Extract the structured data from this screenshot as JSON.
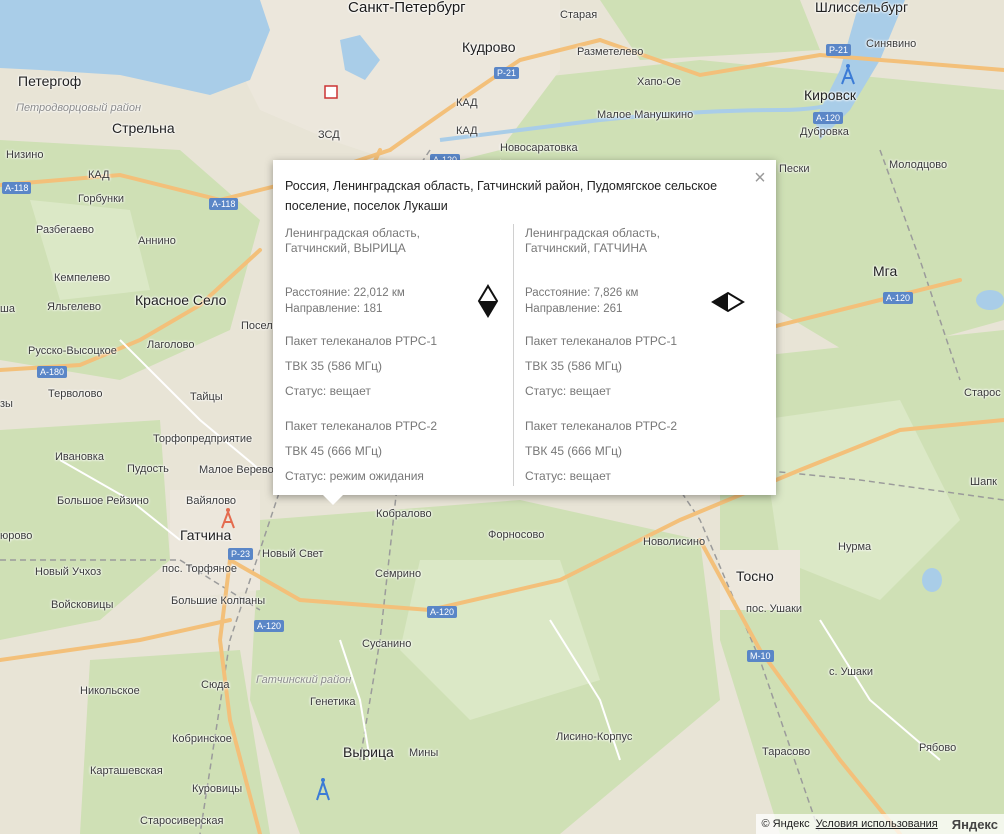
{
  "popup": {
    "address": "Россия, Ленинградская область, Гатчинский район, Пудомягское сельское поселение, поселок Лукаши",
    "close_glyph": "×",
    "left": {
      "location_line1": "Ленинградская область,",
      "location_line2": "Гатчинский, ВЫРИЦА",
      "distance": "Расстояние: 22,012 км",
      "direction": "Направление: 181",
      "direction_value": 181,
      "pack1": "Пакет телеканалов РТРС-1",
      "ch1": "ТВК 35 (586 МГц)",
      "status1": "Статус: вещает",
      "pack2": "Пакет телеканалов РТРС-2",
      "ch2": "ТВК 45 (666 МГц)",
      "status2": "Статус: режим ожидания"
    },
    "right": {
      "location_line1": "Ленинградская область,",
      "location_line2": "Гатчинский, ГАТЧИНА",
      "distance": "Расстояние: 7,826 км",
      "direction": "Направление: 261",
      "direction_value": 261,
      "pack1": "Пакет телеканалов РТРС-1",
      "ch1": "ТВК 35 (586 МГц)",
      "status1": "Статус: вещает",
      "pack2": "Пакет телеканалов РТРС-2",
      "ch2": "ТВК 45 (666 МГц)",
      "status2": "Статус: вещает"
    }
  },
  "map": {
    "labels": {
      "spb": "Санкт-Петербург",
      "shlisselburg": "Шлиссельбург",
      "kirovsk": "Кировск",
      "peterhof": "Петергоф",
      "strelna": "Стрельна",
      "petrodvorets": "Петродворцовый район",
      "kudrovo": "Кудрово",
      "staraya": "Старая",
      "razmetelevo": "Разметелево",
      "khapo_oe": "Хапо-Ое",
      "maloe_manushkino": "Малое Манушкино",
      "novosaratovka": "Новосаратовка",
      "sinyavino": "Синявино",
      "dubrovka": "Дубровка",
      "molodtsovo": "Молодцово",
      "peski": "Пески",
      "nizino": "Низино",
      "gorbunki": "Горбунки",
      "razbegaevo": "Разбегаево",
      "annino": "Аннино",
      "kempelevo": "Кемпелево",
      "yalgelevo": "Яльгелево",
      "krasnoe_selo": "Красное Село",
      "lagolovo": "Лаголово",
      "russko_vysotskoe": "Русско-Высоцкое",
      "tervolovo": "Терволово",
      "taitsy": "Тайцы",
      "torfopredpriyatie": "Торфопредприятие",
      "ivanovka": "Ивановка",
      "pudost": "Пудость",
      "maloe_verevo": "Малое Верево",
      "vayalovo": "Вайялово",
      "bolshoe_reizino": "Большое Рейзино",
      "gatchina": "Гатчина",
      "novy_svet": "Новый Свет",
      "pos_torfyanoe": "пос. Торфяное",
      "novy_uchkhoz": "Новый Учхоз",
      "voyskovitsy": "Войсковицы",
      "bolshie_kolpany": "Большие Колпаны",
      "kobralovo": "Кобралово",
      "fornosovo": "Форносово",
      "semrino": "Семрино",
      "susanino": "Сусанино",
      "gatchinsky_rayon": "Гатчинский район",
      "syuda": "Сюда",
      "nikolskoe": "Никольское",
      "genetika": "Генетика",
      "vyritsa": "Вырица",
      "miny": "Мины",
      "kobrinskoe": "Кобринское",
      "kartashevskaya": "Карташевская",
      "kurovitsy": "Куровицы",
      "starosiverskaya": "Старосиверская",
      "lisino_korpus": "Лисино-Корпус",
      "tarasovo": "Тарасово",
      "ryabovo": "Рябово",
      "s_ushaki": "с. Ушаки",
      "pos_ushaki": "пос. Ушаки",
      "tosno": "Тосно",
      "novolisino": "Новолисино",
      "nurma": "Нурма",
      "mga": "Мга",
      "staros": "Старос",
      "shapk": "Шапк",
      "posel": "Посел",
      "dorovo": "юрово",
      "sha": "ша",
      "zy": "зы"
    },
    "roads": {
      "kad1": "КАД",
      "kad2": "КАД",
      "kad3": "КАД",
      "zsd": "ЗСД",
      "a118a": "А-118",
      "a118b": "А-118",
      "a180": "А-180",
      "a120a": "А-120",
      "a120b": "А-120",
      "a120c": "А-120",
      "a120d": "А-120",
      "a120e": "А-120",
      "p21a": "Р-21",
      "p21b": "Р-21",
      "p23": "Р-23",
      "m10": "М-10"
    },
    "colors": {
      "land": "#e8e4d6",
      "forest": "#cfe0b5",
      "water": "#a9cde8",
      "road_major": "#f3c07a",
      "city": "#ece7dc",
      "tower_active": "#e46b4e",
      "tower_blue": "#3b7bd6"
    }
  },
  "footer": {
    "copyright": "© Яндекс",
    "terms": "Условия использования",
    "logo": "Яндекс"
  }
}
